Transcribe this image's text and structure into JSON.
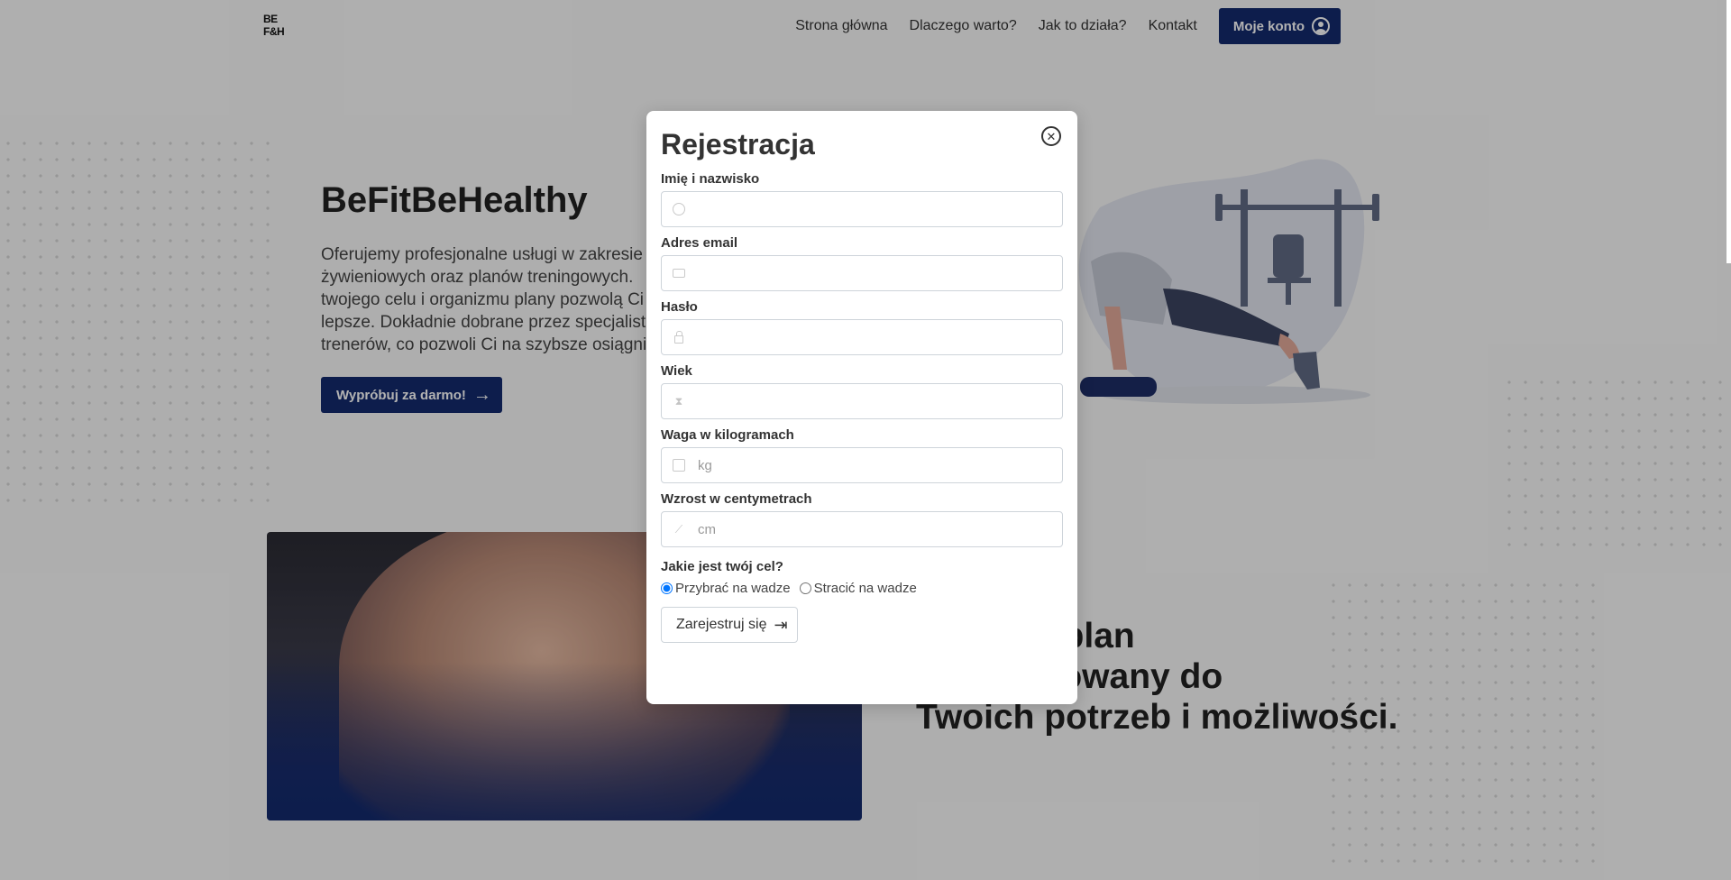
{
  "brand": {
    "logo_text": "BE\nF&H"
  },
  "nav": {
    "links": [
      "Strona główna",
      "Dlaczego warto?",
      "Jak to działa?",
      "Kontakt"
    ],
    "account_label": "Moje konto",
    "account_icon": "user-circle-icon"
  },
  "hero": {
    "title": "BeFitBeHealthy",
    "description": "Oferujemy profesjonalne usługi w zakresie\nżywieniowych oraz planów treningowych. \ntwojego celu i organizmu plany pozwolą Ci\nlepsze. Dokładnie dobrane przez specjalist\ntrenerów, co pozwoli Ci na szybsze osiągni",
    "cta_label": "Wypróbuj za darmo!",
    "cta_icon": "arrow-right-icon"
  },
  "section": {
    "title": "izowany plan\ny dostosowany do\nTwoich potrzeb i możliwości."
  },
  "modal": {
    "title": "Rejestracja",
    "close_icon": "close-circle-icon",
    "fields": [
      {
        "label": "Imię i nazwisko",
        "placeholder": "",
        "value": "",
        "icon": "user-icon"
      },
      {
        "label": "Adres email",
        "placeholder": "",
        "value": "",
        "icon": "mail-icon"
      },
      {
        "label": "Hasło",
        "placeholder": "",
        "value": "",
        "icon": "lock-icon"
      },
      {
        "label": "Wiek",
        "placeholder": "",
        "value": "",
        "icon": "hourglass-icon"
      },
      {
        "label": "Waga w kilogramach",
        "placeholder": "kg",
        "value": "",
        "icon": "scale-icon"
      },
      {
        "label": "Wzrost w centymetrach",
        "placeholder": "cm",
        "value": "",
        "icon": "chart-line-icon"
      }
    ],
    "goal": {
      "label": "Jakie jest twój cel?",
      "options": [
        "Przybrać na wadze",
        "Stracić na wadze"
      ],
      "selected": "Przybrać na wadze"
    },
    "submit_label": "Zarejestruj się",
    "submit_icon": "sign-in-icon"
  },
  "colors": {
    "primary": "#132a6e",
    "overlay": "rgba(0,0,0,0.30)"
  }
}
